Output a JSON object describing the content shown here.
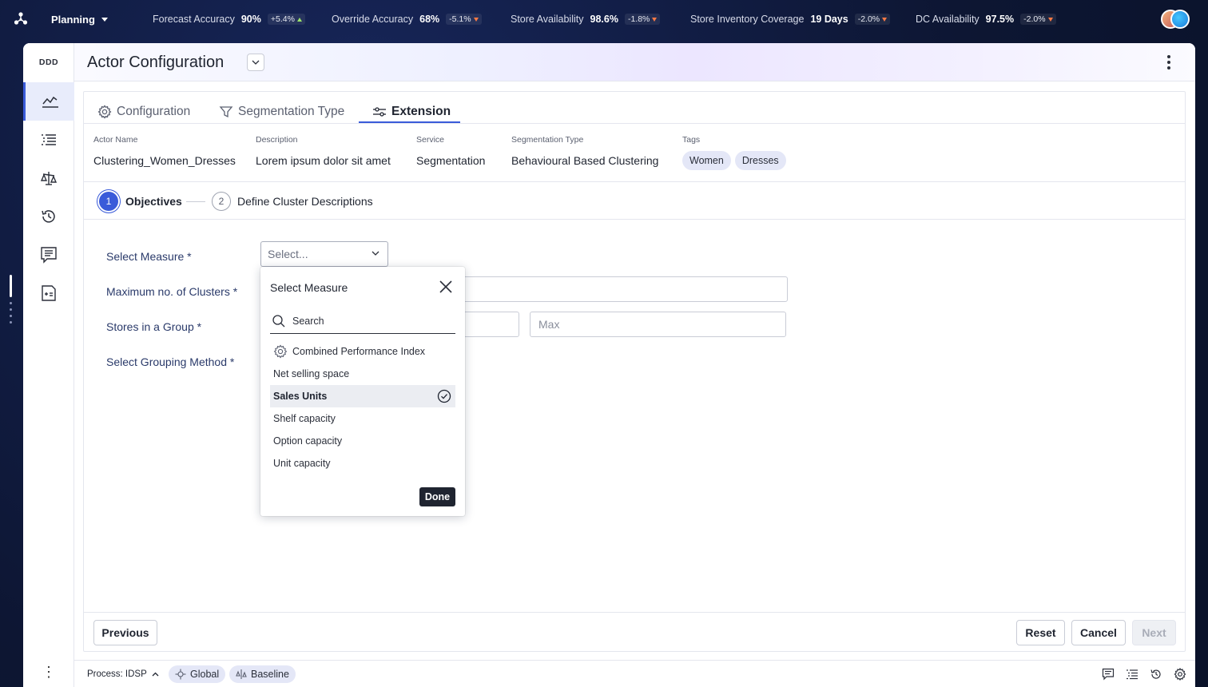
{
  "topbar": {
    "module": "Planning",
    "kpis": [
      {
        "label": "Forecast Accuracy",
        "value": "90%",
        "change": "+5.4%",
        "direction": "up"
      },
      {
        "label": "Override Accuracy",
        "value": "68%",
        "change": "-5.1%",
        "direction": "down"
      },
      {
        "label": "Store Availability",
        "value": "98.6%",
        "change": "-1.8%",
        "direction": "down"
      },
      {
        "label": "Store Inventory Coverage",
        "value": "19 Days",
        "change": "-2.0%",
        "direction": "down"
      },
      {
        "label": "DC Availability",
        "value": "97.5%",
        "change": "-2.0%",
        "direction": "down"
      }
    ]
  },
  "rail": {
    "brand": "DDD",
    "items": [
      "trend-icon",
      "list-icon",
      "scale-icon",
      "history-icon",
      "comment-list-icon",
      "calculator-doc-icon"
    ]
  },
  "header": {
    "title": "Actor Configuration"
  },
  "tabs": [
    {
      "label": "Configuration",
      "icon": "gear-icon"
    },
    {
      "label": "Segmentation Type",
      "icon": "filter-icon"
    },
    {
      "label": "Extension",
      "icon": "sliders-icon",
      "active": true
    }
  ],
  "meta": {
    "actor_name": {
      "label": "Actor Name",
      "value": "Clustering_Women_Dresses"
    },
    "description": {
      "label": "Description",
      "value": "Lorem ipsum dolor sit amet"
    },
    "service": {
      "label": "Service",
      "value": "Segmentation"
    },
    "segmentation_type": {
      "label": "Segmentation Type",
      "value": "Behavioural Based Clustering"
    },
    "tags": {
      "label": "Tags",
      "values": [
        "Women",
        "Dresses"
      ]
    }
  },
  "stepper": {
    "steps": [
      {
        "num": "1",
        "label": "Objectives"
      },
      {
        "num": "2",
        "label": "Define Cluster Descriptions"
      }
    ]
  },
  "form": {
    "select_measure": {
      "label": "Select Measure *",
      "placeholder": "Select..."
    },
    "max_clusters": {
      "label": "Maximum no. of Clusters *"
    },
    "stores_in_group": {
      "label": "Stores in a Group *",
      "max_placeholder": "Max"
    },
    "grouping_method": {
      "label": "Select Grouping Method *"
    }
  },
  "popup": {
    "title": "Select Measure",
    "search_placeholder": "Search",
    "options": [
      {
        "label": "Combined Performance Index",
        "icon": "gear-icon"
      },
      {
        "label": "Net selling space"
      },
      {
        "label": "Sales Units",
        "selected": true
      },
      {
        "label": "Shelf capacity"
      },
      {
        "label": "Option capacity"
      },
      {
        "label": "Unit capacity"
      }
    ],
    "done_label": "Done"
  },
  "buttons": {
    "previous": "Previous",
    "reset": "Reset",
    "cancel": "Cancel",
    "next": "Next"
  },
  "statusbar": {
    "process": "Process: IDSP",
    "chips": [
      "Global",
      "Baseline"
    ]
  },
  "colors": {
    "accent": "#3a5bd9",
    "topbar_bg": "#0f1a3a",
    "tag_bg": "#e4e7f7"
  }
}
